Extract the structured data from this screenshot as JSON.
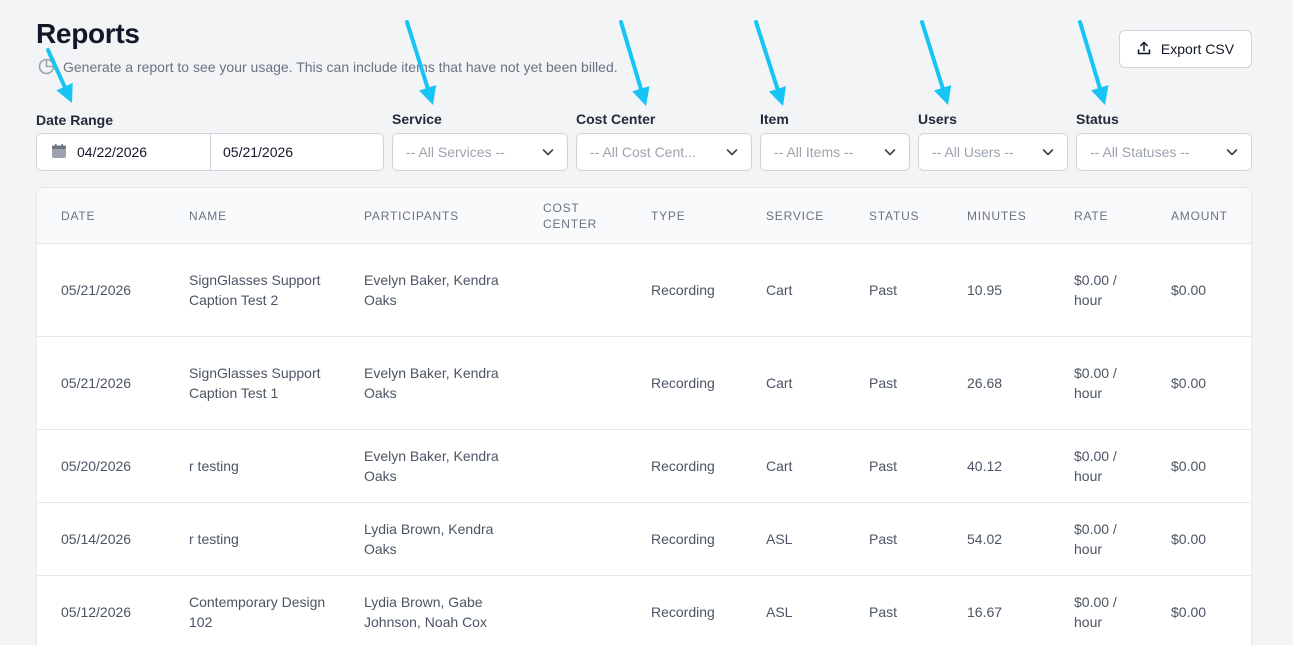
{
  "header": {
    "title": "Reports",
    "subtitle": "Generate a report to see your usage. This can include items that have not yet been billed.",
    "export_label": "Export CSV"
  },
  "filters": {
    "date_range_label": "Date Range",
    "start_date": "04/22/2026",
    "end_date": "05/21/2026",
    "service_label": "Service",
    "service_value": "-- All Services --",
    "cost_center_label": "Cost Center",
    "cost_center_value": "-- All Cost Cent...",
    "item_label": "Item",
    "item_value": "-- All Items --",
    "users_label": "Users",
    "users_value": "-- All Users --",
    "status_label": "Status",
    "status_value": "-- All Statuses --"
  },
  "table": {
    "columns": [
      "DATE",
      "NAME",
      "PARTICIPANTS",
      "COST CENTER",
      "TYPE",
      "SERVICE",
      "STATUS",
      "MINUTES",
      "RATE",
      "AMOUNT"
    ],
    "rows": [
      {
        "date": "05/21/2026",
        "name": "SignGlasses Support Caption Test 2",
        "participants": "Evelyn Baker, Kendra Oaks",
        "cost_center": "",
        "type": "Recording",
        "service": "Cart",
        "status": "Past",
        "minutes": "10.95",
        "rate": "$0.00 / hour",
        "amount": "$0.00"
      },
      {
        "date": "05/21/2026",
        "name": "SignGlasses Support Caption Test 1",
        "participants": "Evelyn Baker, Kendra Oaks",
        "cost_center": "",
        "type": "Recording",
        "service": "Cart",
        "status": "Past",
        "minutes": "26.68",
        "rate": "$0.00 / hour",
        "amount": "$0.00"
      },
      {
        "date": "05/20/2026",
        "name": "r testing",
        "participants": "Evelyn Baker, Kendra Oaks",
        "cost_center": "",
        "type": "Recording",
        "service": "Cart",
        "status": "Past",
        "minutes": "40.12",
        "rate": "$0.00 / hour",
        "amount": "$0.00"
      },
      {
        "date": "05/14/2026",
        "name": "r testing",
        "participants": "Lydia Brown, Kendra Oaks",
        "cost_center": "",
        "type": "Recording",
        "service": "ASL",
        "status": "Past",
        "minutes": "54.02",
        "rate": "$0.00 / hour",
        "amount": "$0.00"
      },
      {
        "date": "05/12/2026",
        "name": "Contemporary Design 102",
        "participants": "Lydia Brown, Gabe Johnson, Noah Cox",
        "cost_center": "",
        "type": "Recording",
        "service": "ASL",
        "status": "Past",
        "minutes": "16.67",
        "rate": "$0.00 / hour",
        "amount": "$0.00"
      }
    ]
  },
  "annotations": {
    "arrow_color": "#16c5f3",
    "arrow_count": 6
  }
}
